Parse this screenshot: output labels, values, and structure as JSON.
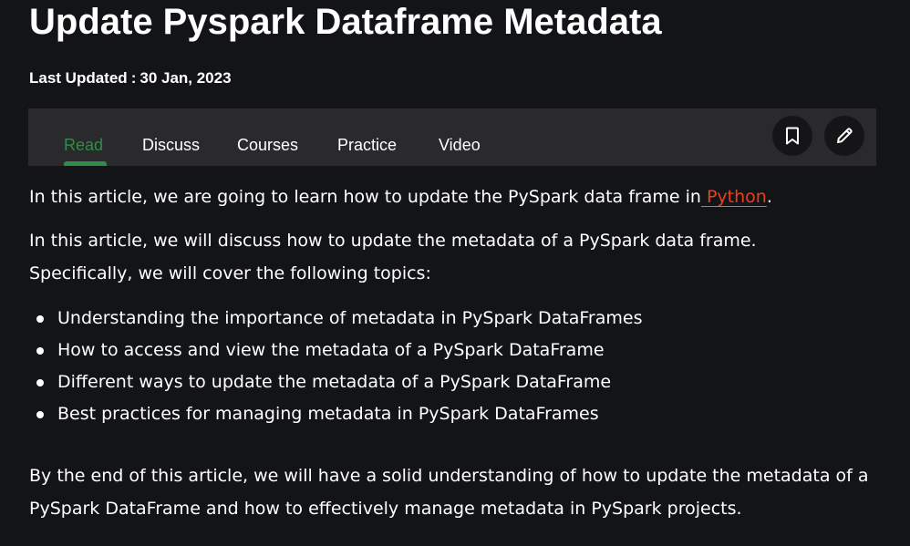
{
  "article": {
    "title": "Update Pyspark Dataframe Metadata",
    "updated_label": "Last Updated",
    "updated_sep": ":",
    "updated_date": "30 Jan, 2023"
  },
  "tabs": {
    "read": "Read",
    "discuss": "Discuss",
    "courses": "Courses",
    "practice": "Practice",
    "video": "Video"
  },
  "icons": {
    "bookmark": "bookmark-icon",
    "edit": "pencil-icon"
  },
  "body": {
    "p1_text": "In this article, we are going to learn how to update the PySpark data frame in",
    "p1_link": " Python",
    "p1_end": ".",
    "p2": "In this article, we will discuss how to update the metadata of a PySpark data frame. Specifically, we will cover the following topics:",
    "topics": [
      "Understanding the importance of metadata in PySpark DataFrames",
      "How to access and view the metadata of a PySpark DataFrame",
      "Different ways to update the metadata of a PySpark DataFrame",
      "Best practices for managing metadata in PySpark DataFrames"
    ],
    "p3": "By the end of this article, we will have a solid understanding of how to update the metadata of a PySpark DataFrame and how to effectively manage metadata in PySpark projects."
  },
  "colors": {
    "background": "#131417",
    "tabbar": "#2a2a2c",
    "accent": "#2f8d46",
    "link": "#e8411e"
  }
}
